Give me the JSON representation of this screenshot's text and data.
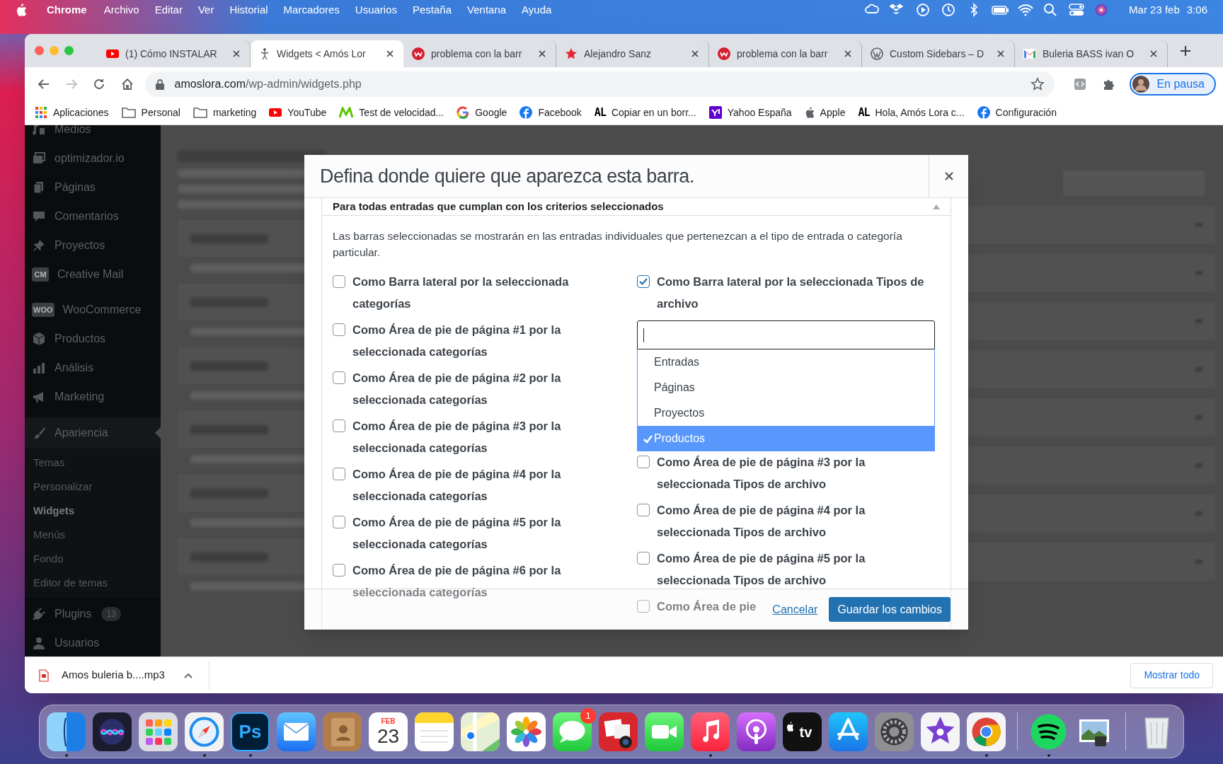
{
  "menu_bar": {
    "app": "Chrome",
    "menus": [
      "Archivo",
      "Editar",
      "Ver",
      "Historial",
      "Marcadores",
      "Usuarios",
      "Pestaña",
      "Ventana",
      "Ayuda"
    ],
    "date": "Mar 23 feb",
    "time": "3:06"
  },
  "tabs": [
    {
      "title": "(1) Cómo INSTALAR",
      "kind": "youtube",
      "selected": false
    },
    {
      "title": "Widgets < Amós Lor",
      "kind": "figure",
      "selected": true
    },
    {
      "title": "problema con la barr",
      "kind": "wcircle",
      "selected": false
    },
    {
      "title": "Alejandro Sanz",
      "kind": "star",
      "selected": false
    },
    {
      "title": "problema con la barr",
      "kind": "wcircle",
      "selected": false
    },
    {
      "title": "Custom Sidebars – D",
      "kind": "wordpress",
      "selected": false
    },
    {
      "title": "Buleria BASS ivan O",
      "kind": "gmail",
      "selected": false
    }
  ],
  "address_bar": {
    "host": "amoslora.com",
    "path": "/wp-admin/widgets.php"
  },
  "profile_button": "En pausa",
  "bookmarks": [
    {
      "label": "Aplicaciones",
      "kind": "apps"
    },
    {
      "label": "Personal",
      "kind": "folder"
    },
    {
      "label": "marketing",
      "kind": "folder"
    },
    {
      "label": "YouTube",
      "kind": "youtube"
    },
    {
      "label": "Test de velocidad...",
      "kind": "zigzag"
    },
    {
      "label": "Google",
      "kind": "google"
    },
    {
      "label": "Facebook",
      "kind": "facebook"
    },
    {
      "label": "Copiar en un borr...",
      "kind": "text",
      "icon_text": "AL"
    },
    {
      "label": "Yahoo España",
      "kind": "yahoo"
    },
    {
      "label": "Apple",
      "kind": "apple"
    },
    {
      "label": "Hola, Amós Lora c...",
      "kind": "text",
      "icon_text": "AL"
    },
    {
      "label": "Configuración",
      "kind": "facebook"
    }
  ],
  "sidebar": {
    "groups": [
      [
        {
          "label": "Medios",
          "kind": "media",
          "selected": false
        },
        {
          "label": "optimizador.io",
          "kind": "images",
          "selected": false
        },
        {
          "label": "Páginas",
          "kind": "pages",
          "selected": false
        },
        {
          "label": "Comentarios",
          "kind": "comment",
          "selected": false
        },
        {
          "label": "Proyectos",
          "kind": "pin",
          "selected": false
        },
        {
          "label": "Creative Mail",
          "kind": "text",
          "icon_text": "CM",
          "selected": false
        }
      ],
      [
        {
          "label": "WooCommerce",
          "kind": "text",
          "icon_text": "WOO",
          "selected": false
        },
        {
          "label": "Productos",
          "kind": "box",
          "selected": false
        },
        {
          "label": "Análisis",
          "kind": "bars",
          "selected": false
        },
        {
          "label": "Marketing",
          "kind": "megaphone",
          "selected": false
        }
      ],
      [
        {
          "label": "Apariencia",
          "kind": "brush",
          "selected": true,
          "children": [
            {
              "label": "Temas",
              "selected": false
            },
            {
              "label": "Personalizar",
              "selected": false
            },
            {
              "label": "Widgets",
              "selected": true
            },
            {
              "label": "Menús",
              "selected": false
            },
            {
              "label": "Fondo",
              "selected": false
            },
            {
              "label": "Editor de temas",
              "selected": false
            }
          ]
        },
        {
          "label": "Plugins",
          "kind": "plug",
          "badge": "13",
          "selected": false
        },
        {
          "label": "Usuarios",
          "kind": "user",
          "selected": false
        }
      ]
    ]
  },
  "modal": {
    "title": "Defina donde quiere que aparezca esta barra.",
    "section_title": "Para todas entradas que cumplan con los criterios seleccionados",
    "description": "Las barras seleccionadas se mostrarán en las entradas individuales que pertenezcan a el tipo de entrada o categoría particular.",
    "left_column": [
      {
        "kind": "checkbox",
        "label": "Como Barra lateral por la seleccionada categorías",
        "checked": false
      },
      {
        "kind": "checkbox",
        "label": "Como Área de pie de página #1 por la seleccionada categorías",
        "checked": false
      },
      {
        "kind": "checkbox",
        "label": "Como Área de pie de página #2 por la seleccionada categorías",
        "checked": false
      },
      {
        "kind": "checkbox",
        "label": "Como Área de pie de página #3 por la seleccionada categorías",
        "checked": false
      },
      {
        "kind": "checkbox",
        "label": "Como Área de pie de página #4 por la seleccionada categorías",
        "checked": false
      },
      {
        "kind": "checkbox",
        "label": "Como Área de pie de página #5 por la seleccionada categorías",
        "checked": false
      },
      {
        "kind": "checkbox",
        "label": "Como Área de pie de página #6 por la seleccionada categorías",
        "checked": false
      }
    ],
    "right_column": [
      {
        "kind": "checkbox",
        "label": "Como Barra lateral por la seleccionada Tipos de archivo",
        "checked": true
      },
      {
        "kind": "select",
        "options": [
          {
            "label": "Entradas",
            "selected": false
          },
          {
            "label": "Páginas",
            "selected": false
          },
          {
            "label": "Proyectos",
            "selected": false
          },
          {
            "label": "Productos",
            "selected": true
          }
        ]
      },
      {
        "kind": "checkbox",
        "label": "Como Área de pie de página #3 por la seleccionada Tipos de archivo",
        "checked": false
      },
      {
        "kind": "checkbox",
        "label": "Como Área de pie de página #4 por la seleccionada Tipos de archivo",
        "checked": false
      },
      {
        "kind": "checkbox",
        "label": "Como Área de pie de página #5 por la seleccionada Tipos de archivo",
        "checked": false
      },
      {
        "kind": "checkbox",
        "label": "Como Área de pie",
        "checked": false
      }
    ],
    "cancel": "Cancelar",
    "save": "Guardar los cambios"
  },
  "download_bar": {
    "file": "Amos buleria b....mp3",
    "show_all": "Mostrar todo"
  },
  "dock": [
    {
      "kind": "finder",
      "running": true
    },
    {
      "kind": "siri",
      "running": false
    },
    {
      "kind": "launchpad",
      "running": false
    },
    {
      "kind": "safari",
      "running": true
    },
    {
      "kind": "photoshop",
      "label": "Ps",
      "running": true
    },
    {
      "kind": "mail",
      "running": false
    },
    {
      "kind": "contacts",
      "running": false
    },
    {
      "kind": "calendar",
      "month": "FEB",
      "day": "23",
      "running": false
    },
    {
      "kind": "notes",
      "running": false
    },
    {
      "kind": "maps",
      "running": false
    },
    {
      "kind": "photos",
      "running": false
    },
    {
      "kind": "messages",
      "badge": "1",
      "running": false
    },
    {
      "kind": "photobooth",
      "running": false
    },
    {
      "kind": "facetime",
      "running": false
    },
    {
      "kind": "music",
      "running": true
    },
    {
      "kind": "podcasts",
      "running": false
    },
    {
      "kind": "tv",
      "label": "tv",
      "running": false
    },
    {
      "kind": "appstore",
      "running": false
    },
    {
      "kind": "settings",
      "running": false
    },
    {
      "kind": "imovie",
      "running": false
    },
    {
      "kind": "chrome",
      "running": true
    },
    {
      "kind": "separator"
    },
    {
      "kind": "spotify",
      "running": true
    },
    {
      "kind": "preview",
      "running": false
    },
    {
      "kind": "separator"
    },
    {
      "kind": "trash",
      "running": false
    }
  ]
}
